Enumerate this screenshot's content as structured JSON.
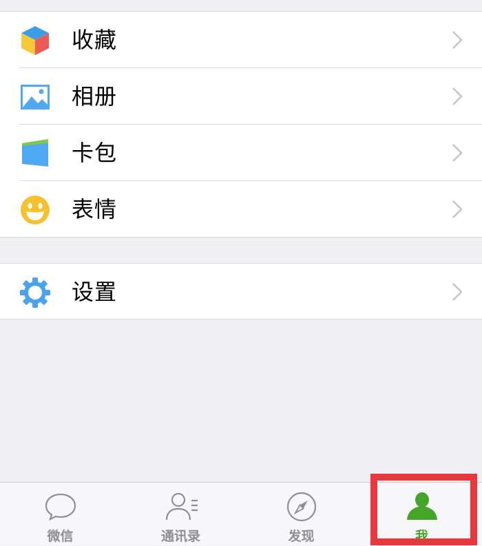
{
  "menu": {
    "group1": [
      {
        "id": "favorites",
        "label": "收藏",
        "icon": "cube-icon"
      },
      {
        "id": "album",
        "label": "相册",
        "icon": "picture-icon"
      },
      {
        "id": "wallet",
        "label": "卡包",
        "icon": "card-wallet-icon"
      },
      {
        "id": "stickers",
        "label": "表情",
        "icon": "smiley-icon"
      }
    ],
    "group2": [
      {
        "id": "settings",
        "label": "设置",
        "icon": "gear-icon"
      }
    ]
  },
  "tabbar": {
    "tabs": [
      {
        "label": "微信",
        "icon": "chat-bubble-icon",
        "active": false
      },
      {
        "label": "通讯录",
        "icon": "contacts-icon",
        "active": false
      },
      {
        "label": "发现",
        "icon": "compass-icon",
        "active": false
      },
      {
        "label": "我",
        "icon": "person-icon",
        "active": true
      }
    ]
  },
  "colors": {
    "background": "#efeff4",
    "active_tab": "#45a52b",
    "inactive_tab": "#8e8e93",
    "highlight": "#e8383d",
    "icon_blue": "#4aa3f0",
    "icon_yellow": "#f5c12e"
  }
}
